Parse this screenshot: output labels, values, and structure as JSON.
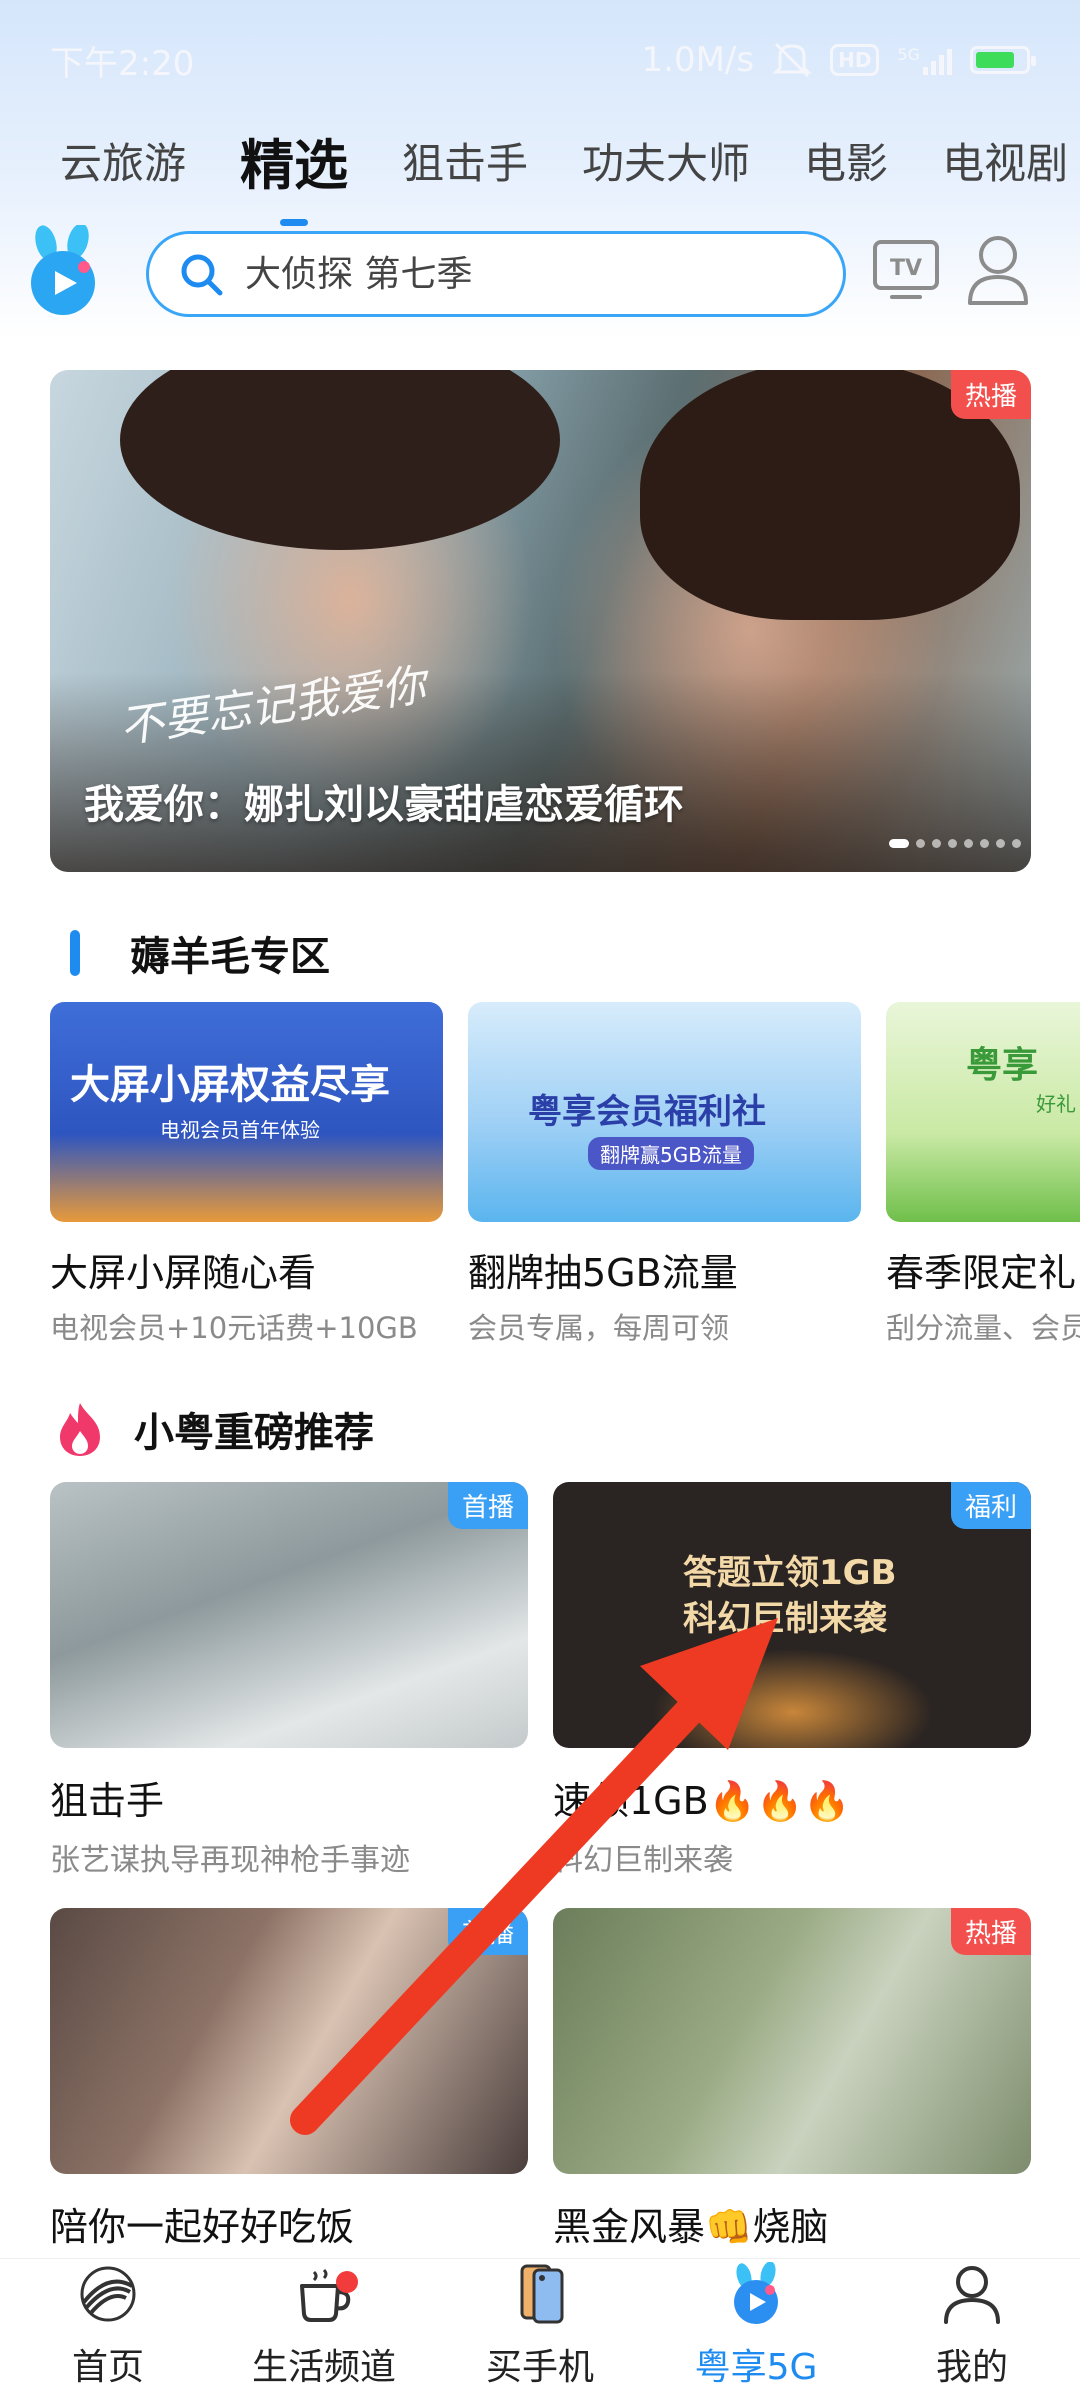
{
  "status_bar": {
    "time": "下午2:20",
    "speed": "1.0M/s",
    "hd": "HD",
    "network": "5G"
  },
  "top_tabs": [
    {
      "label": "云旅游",
      "active": false
    },
    {
      "label": "精选",
      "active": true
    },
    {
      "label": "狙击手",
      "active": false
    },
    {
      "label": "功夫大师",
      "active": false
    },
    {
      "label": "电影",
      "active": false
    },
    {
      "label": "电视剧",
      "active": false
    }
  ],
  "search": {
    "placeholder": "大侦探 第七季",
    "search_icon": "search-icon",
    "tv_icon": "tv-icon",
    "user_icon": "user-icon"
  },
  "banner": {
    "tag": "热播",
    "script_text": "不要忘记我爱你",
    "title": "我爱你：娜扎刘以豪甜虐恋爱循环",
    "dot_count": 8,
    "active_dot": 0
  },
  "section_wool": {
    "title": "薅羊毛专区"
  },
  "promos": [
    {
      "title": "大屏小屏随心看",
      "subtitle": "电视会员+10元话费+10GB",
      "image_text": "大屏小屏权益尽享",
      "image_subtext": "电视会员首年体验"
    },
    {
      "title": "翻牌抽5GB流量",
      "subtitle": "会员专属，每周可领",
      "image_text": "粤享会员福利社",
      "image_subtext": "翻牌赢5GB流量"
    },
    {
      "title": "春季限定礼",
      "subtitle": "刮分流量、会员",
      "image_text": "粤享",
      "image_subtext": "好礼"
    }
  ],
  "section_recommend": {
    "title": "小粤重磅推荐"
  },
  "recommends": [
    {
      "tag": "首播",
      "tag_color": "#3aa0f5",
      "title": "狙击手",
      "subtitle": "张艺谋执导再现神枪手事迹",
      "image_text": ""
    },
    {
      "tag": "福利",
      "tag_color": "#3aa0f5",
      "title": "速领1GB🔥🔥🔥",
      "subtitle": "科幻巨制来袭",
      "image_text": "答题立领1GB 科幻巨制来袭"
    },
    {
      "tag": "首播",
      "tag_color": "#3aa0f5",
      "title": "陪你一起好好吃饭",
      "subtitle": "",
      "image_text": ""
    },
    {
      "tag": "热播",
      "tag_color": "#f3504d",
      "title": "黑金风暴👊烧脑",
      "subtitle": "",
      "image_text": ""
    }
  ],
  "bottom_nav": [
    {
      "label": "首页",
      "icon": "china-mobile-logo-icon",
      "active": false
    },
    {
      "label": "生活频道",
      "icon": "coffee-cup-icon",
      "active": false,
      "badge": true
    },
    {
      "label": "买手机",
      "icon": "phone-icon",
      "active": false
    },
    {
      "label": "粤享5G",
      "icon": "rabbit-play-icon",
      "active": true
    },
    {
      "label": "我的",
      "icon": "person-icon",
      "active": false
    }
  ],
  "colors": {
    "accent": "#1e8bf0",
    "hot_tag": "#f3504d",
    "arrow": "#ee3a22"
  }
}
